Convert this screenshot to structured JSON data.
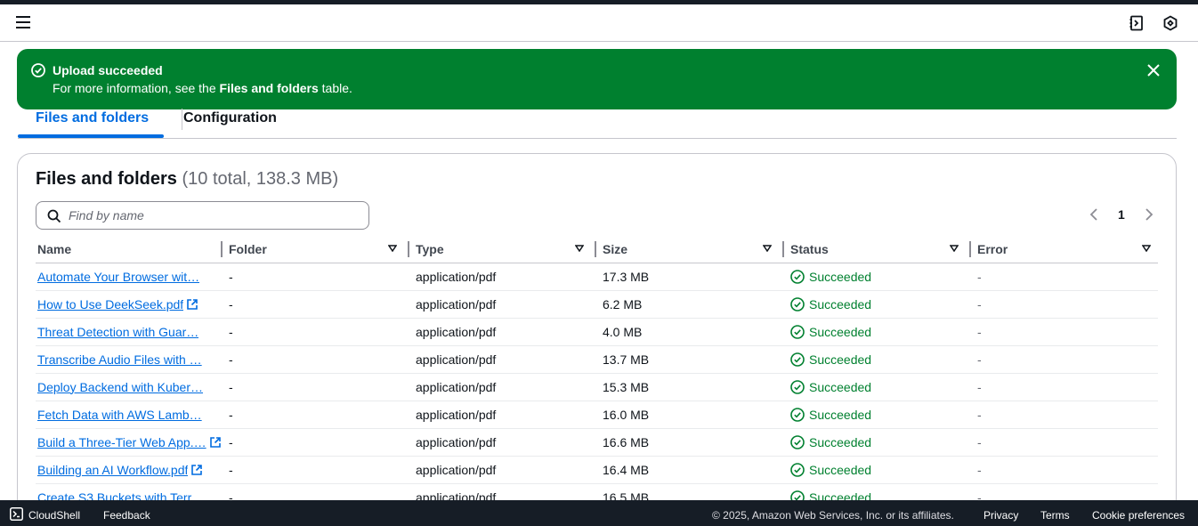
{
  "flash": {
    "title": "Upload succeeded",
    "message_prefix": "For more information, see the ",
    "message_bold": "Files and folders",
    "message_suffix": " table."
  },
  "tabs": [
    {
      "label": "Files and folders",
      "active": true
    },
    {
      "label": "Configuration",
      "active": false
    }
  ],
  "files": {
    "title": "Files and folders",
    "count": "(10 total, 138.3 MB)",
    "search_placeholder": "Find by name",
    "page": "1",
    "columns": [
      "Name",
      "Folder",
      "Type",
      "Size",
      "Status",
      "Error"
    ],
    "rows": [
      {
        "name": "Automate Your Browser wit…",
        "folder": "-",
        "type": "application/pdf",
        "size": "17.3 MB",
        "status": "Succeeded",
        "error": "-",
        "ext_icon": false
      },
      {
        "name": "How to Use DeekSeek.pdf",
        "folder": "-",
        "type": "application/pdf",
        "size": "6.2 MB",
        "status": "Succeeded",
        "error": "-",
        "ext_icon": true
      },
      {
        "name": "Threat Detection with Guar…",
        "folder": "-",
        "type": "application/pdf",
        "size": "4.0 MB",
        "status": "Succeeded",
        "error": "-",
        "ext_icon": false
      },
      {
        "name": "Transcribe Audio Files with …",
        "folder": "-",
        "type": "application/pdf",
        "size": "13.7 MB",
        "status": "Succeeded",
        "error": "-",
        "ext_icon": false
      },
      {
        "name": "Deploy Backend with Kuber…",
        "folder": "-",
        "type": "application/pdf",
        "size": "15.3 MB",
        "status": "Succeeded",
        "error": "-",
        "ext_icon": false
      },
      {
        "name": "Fetch Data with AWS Lamb…",
        "folder": "-",
        "type": "application/pdf",
        "size": "16.0 MB",
        "status": "Succeeded",
        "error": "-",
        "ext_icon": false
      },
      {
        "name": "Build a Three-Tier Web App.…",
        "folder": "-",
        "type": "application/pdf",
        "size": "16.6 MB",
        "status": "Succeeded",
        "error": "-",
        "ext_icon": true
      },
      {
        "name": "Building an AI Workflow.pdf",
        "folder": "-",
        "type": "application/pdf",
        "size": "16.4 MB",
        "status": "Succeeded",
        "error": "-",
        "ext_icon": true
      },
      {
        "name": "Create S3 Buckets with Terr…",
        "folder": "-",
        "type": "application/pdf",
        "size": "16.5 MB",
        "status": "Succeeded",
        "error": "-",
        "ext_icon": false
      }
    ]
  },
  "footer": {
    "cloudshell": "CloudShell",
    "feedback": "Feedback",
    "copyright": "© 2025, Amazon Web Services, Inc. or its affiliates.",
    "privacy": "Privacy",
    "terms": "Terms",
    "cookie": "Cookie preferences"
  },
  "colors": {
    "success": "#00802f",
    "link": "#006ce0",
    "footer_bg": "#161d26"
  }
}
